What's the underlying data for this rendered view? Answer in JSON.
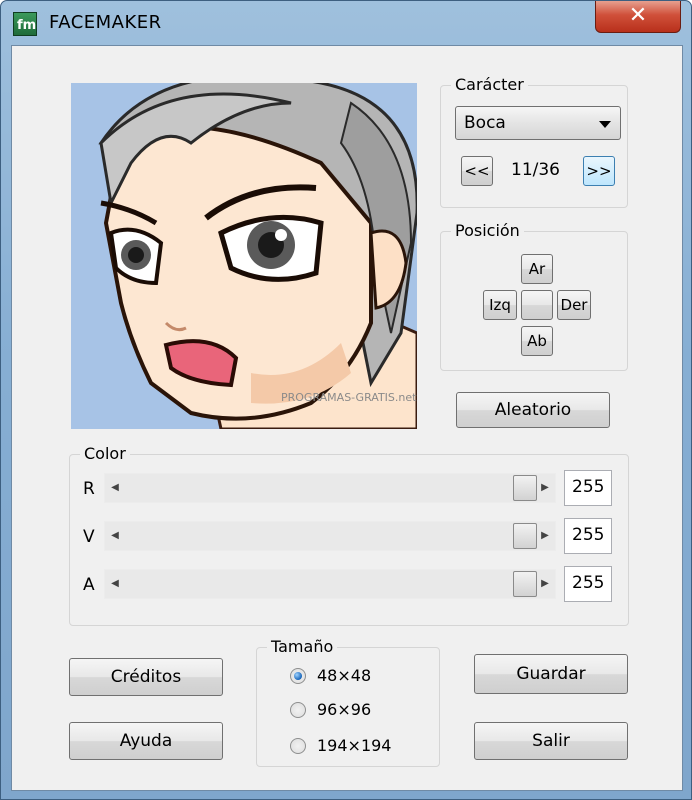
{
  "window": {
    "title": "FACEMAKER",
    "close_label": "✕"
  },
  "preview": {
    "watermark": "PROGRAMAS-GRATIS.net"
  },
  "caracter": {
    "group_label": "Carácter",
    "selected_part": "Boca",
    "prev_label": "<<",
    "counter": "11/36",
    "next_label": ">>"
  },
  "posicion": {
    "group_label": "Posición",
    "up_label": "Ar",
    "left_label": "Izq",
    "center_label": "",
    "right_label": "Der",
    "down_label": "Ab"
  },
  "aleatorio_label": "Aleatorio",
  "color": {
    "group_label": "Color",
    "channels": [
      {
        "label": "R",
        "value": "255",
        "level": 1.0
      },
      {
        "label": "V",
        "value": "255",
        "level": 1.0
      },
      {
        "label": "A",
        "value": "255",
        "level": 1.0
      }
    ]
  },
  "tamano": {
    "group_label": "Tamaño",
    "options": [
      {
        "label": "48×48",
        "selected": true
      },
      {
        "label": "96×96",
        "selected": false
      },
      {
        "label": "194×194",
        "selected": false
      }
    ]
  },
  "buttons": {
    "creditos": "Créditos",
    "ayuda": "Ayuda",
    "guardar": "Guardar",
    "salir": "Salir"
  }
}
